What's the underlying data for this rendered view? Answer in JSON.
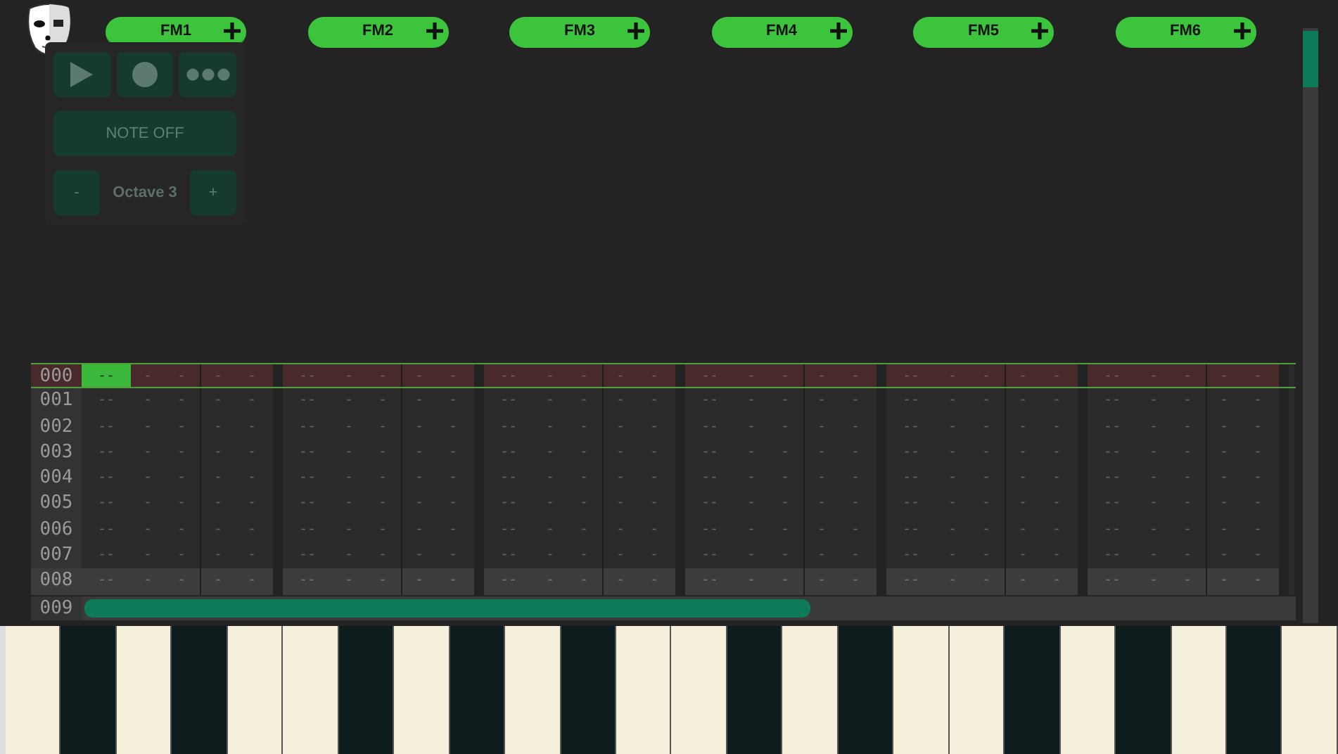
{
  "tracks": [
    {
      "label": "FM1",
      "selected": true
    },
    {
      "label": "FM2",
      "selected": false
    },
    {
      "label": "FM3",
      "selected": false
    },
    {
      "label": "FM4",
      "selected": false
    },
    {
      "label": "FM5",
      "selected": false
    },
    {
      "label": "FM6",
      "selected": false
    }
  ],
  "controls": {
    "buttons": [
      {
        "kind": "play"
      },
      {
        "kind": "record"
      },
      {
        "kind": "more"
      }
    ],
    "note_off": "NOTE OFF",
    "octave_down": "-",
    "octave": "Octave 3",
    "octave_up": "+"
  },
  "pattern": {
    "rows": [
      {
        "number": "000",
        "kind": "cursor",
        "channels": [
          {
            "cells": [
              "--",
              "-",
              "-",
              "-",
              "-"
            ],
            "selected": true
          },
          {
            "cells": [
              "--",
              "-",
              "-",
              "-",
              "-"
            ],
            "selected": false
          },
          {
            "cells": [
              "--",
              "-",
              "-",
              "-",
              "-"
            ],
            "selected": false
          },
          {
            "cells": [
              "--",
              "-",
              "-",
              "-",
              "-"
            ],
            "selected": false
          },
          {
            "cells": [
              "--",
              "-",
              "-",
              "-",
              "-"
            ],
            "selected": false
          },
          {
            "cells": [
              "--",
              "-",
              "-",
              "-",
              "-"
            ],
            "selected": false
          }
        ]
      },
      {
        "number": "001",
        "kind": "normal",
        "channels": [
          {
            "cells": [
              "--",
              "-",
              "-",
              "-",
              "-"
            ],
            "selected": false
          },
          {
            "cells": [
              "--",
              "-",
              "-",
              "-",
              "-"
            ],
            "selected": false
          },
          {
            "cells": [
              "--",
              "-",
              "-",
              "-",
              "-"
            ],
            "selected": false
          },
          {
            "cells": [
              "--",
              "-",
              "-",
              "-",
              "-"
            ],
            "selected": false
          },
          {
            "cells": [
              "--",
              "-",
              "-",
              "-",
              "-"
            ],
            "selected": false
          },
          {
            "cells": [
              "--",
              "-",
              "-",
              "-",
              "-"
            ],
            "selected": false
          }
        ]
      },
      {
        "number": "002",
        "kind": "normal",
        "channels": [
          {
            "cells": [
              "--",
              "-",
              "-",
              "-",
              "-"
            ],
            "selected": false
          },
          {
            "cells": [
              "--",
              "-",
              "-",
              "-",
              "-"
            ],
            "selected": false
          },
          {
            "cells": [
              "--",
              "-",
              "-",
              "-",
              "-"
            ],
            "selected": false
          },
          {
            "cells": [
              "--",
              "-",
              "-",
              "-",
              "-"
            ],
            "selected": false
          },
          {
            "cells": [
              "--",
              "-",
              "-",
              "-",
              "-"
            ],
            "selected": false
          },
          {
            "cells": [
              "--",
              "-",
              "-",
              "-",
              "-"
            ],
            "selected": false
          }
        ]
      },
      {
        "number": "003",
        "kind": "normal",
        "channels": [
          {
            "cells": [
              "--",
              "-",
              "-",
              "-",
              "-"
            ],
            "selected": false
          },
          {
            "cells": [
              "--",
              "-",
              "-",
              "-",
              "-"
            ],
            "selected": false
          },
          {
            "cells": [
              "--",
              "-",
              "-",
              "-",
              "-"
            ],
            "selected": false
          },
          {
            "cells": [
              "--",
              "-",
              "-",
              "-",
              "-"
            ],
            "selected": false
          },
          {
            "cells": [
              "--",
              "-",
              "-",
              "-",
              "-"
            ],
            "selected": false
          },
          {
            "cells": [
              "--",
              "-",
              "-",
              "-",
              "-"
            ],
            "selected": false
          }
        ]
      },
      {
        "number": "004",
        "kind": "normal",
        "channels": [
          {
            "cells": [
              "--",
              "-",
              "-",
              "-",
              "-"
            ],
            "selected": false
          },
          {
            "cells": [
              "--",
              "-",
              "-",
              "-",
              "-"
            ],
            "selected": false
          },
          {
            "cells": [
              "--",
              "-",
              "-",
              "-",
              "-"
            ],
            "selected": false
          },
          {
            "cells": [
              "--",
              "-",
              "-",
              "-",
              "-"
            ],
            "selected": false
          },
          {
            "cells": [
              "--",
              "-",
              "-",
              "-",
              "-"
            ],
            "selected": false
          },
          {
            "cells": [
              "--",
              "-",
              "-",
              "-",
              "-"
            ],
            "selected": false
          }
        ]
      },
      {
        "number": "005",
        "kind": "normal",
        "channels": [
          {
            "cells": [
              "--",
              "-",
              "-",
              "-",
              "-"
            ],
            "selected": false
          },
          {
            "cells": [
              "--",
              "-",
              "-",
              "-",
              "-"
            ],
            "selected": false
          },
          {
            "cells": [
              "--",
              "-",
              "-",
              "-",
              "-"
            ],
            "selected": false
          },
          {
            "cells": [
              "--",
              "-",
              "-",
              "-",
              "-"
            ],
            "selected": false
          },
          {
            "cells": [
              "--",
              "-",
              "-",
              "-",
              "-"
            ],
            "selected": false
          },
          {
            "cells": [
              "--",
              "-",
              "-",
              "-",
              "-"
            ],
            "selected": false
          }
        ]
      },
      {
        "number": "006",
        "kind": "normal",
        "channels": [
          {
            "cells": [
              "--",
              "-",
              "-",
              "-",
              "-"
            ],
            "selected": false
          },
          {
            "cells": [
              "--",
              "-",
              "-",
              "-",
              "-"
            ],
            "selected": false
          },
          {
            "cells": [
              "--",
              "-",
              "-",
              "-",
              "-"
            ],
            "selected": false
          },
          {
            "cells": [
              "--",
              "-",
              "-",
              "-",
              "-"
            ],
            "selected": false
          },
          {
            "cells": [
              "--",
              "-",
              "-",
              "-",
              "-"
            ],
            "selected": false
          },
          {
            "cells": [
              "--",
              "-",
              "-",
              "-",
              "-"
            ],
            "selected": false
          }
        ]
      },
      {
        "number": "007",
        "kind": "normal",
        "channels": [
          {
            "cells": [
              "--",
              "-",
              "-",
              "-",
              "-"
            ],
            "selected": false
          },
          {
            "cells": [
              "--",
              "-",
              "-",
              "-",
              "-"
            ],
            "selected": false
          },
          {
            "cells": [
              "--",
              "-",
              "-",
              "-",
              "-"
            ],
            "selected": false
          },
          {
            "cells": [
              "--",
              "-",
              "-",
              "-",
              "-"
            ],
            "selected": false
          },
          {
            "cells": [
              "--",
              "-",
              "-",
              "-",
              "-"
            ],
            "selected": false
          },
          {
            "cells": [
              "--",
              "-",
              "-",
              "-",
              "-"
            ],
            "selected": false
          }
        ]
      },
      {
        "number": "008",
        "kind": "beat",
        "channels": [
          {
            "cells": [
              "--",
              "-",
              "-",
              "-",
              "-"
            ],
            "selected": false
          },
          {
            "cells": [
              "--",
              "-",
              "-",
              "-",
              "-"
            ],
            "selected": false
          },
          {
            "cells": [
              "--",
              "-",
              "-",
              "-",
              "-"
            ],
            "selected": false
          },
          {
            "cells": [
              "--",
              "-",
              "-",
              "-",
              "-"
            ],
            "selected": false
          },
          {
            "cells": [
              "--",
              "-",
              "-",
              "-",
              "-"
            ],
            "selected": false
          },
          {
            "cells": [
              "--",
              "-",
              "-",
              "-",
              "-"
            ],
            "selected": false
          }
        ]
      }
    ],
    "footer_row": {
      "number": "009"
    }
  },
  "keyboard": {
    "keys": [
      {
        "kind": "white"
      },
      {
        "kind": "black"
      },
      {
        "kind": "white"
      },
      {
        "kind": "black"
      },
      {
        "kind": "white"
      },
      {
        "kind": "white"
      },
      {
        "kind": "black"
      },
      {
        "kind": "white"
      },
      {
        "kind": "black"
      },
      {
        "kind": "white"
      },
      {
        "kind": "black"
      },
      {
        "kind": "white"
      },
      {
        "kind": "white"
      },
      {
        "kind": "black"
      },
      {
        "kind": "white"
      },
      {
        "kind": "black"
      },
      {
        "kind": "white"
      },
      {
        "kind": "white"
      },
      {
        "kind": "black"
      },
      {
        "kind": "white"
      },
      {
        "kind": "black"
      },
      {
        "kind": "white"
      },
      {
        "kind": "black"
      },
      {
        "kind": "white"
      }
    ]
  }
}
